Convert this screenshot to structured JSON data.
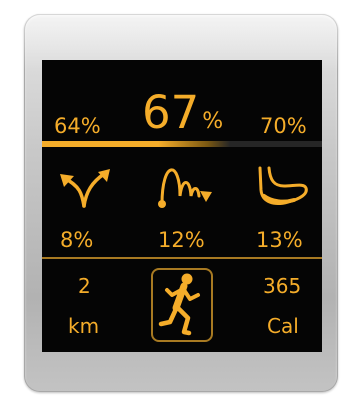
{
  "header": {
    "left_value": "64%",
    "main_value": "67",
    "main_unit": "%",
    "right_value": "70%",
    "progress_fraction": 0.67
  },
  "metrics": [
    {
      "icon": "direction-arrows-icon",
      "value": "8%"
    },
    {
      "icon": "bounce-wave-icon",
      "value": "12%"
    },
    {
      "icon": "foot-icon",
      "value": "13%"
    }
  ],
  "footer": {
    "distance_value": "2",
    "distance_unit": "km",
    "activity_icon": "runner-icon",
    "calories_value": "365",
    "calories_unit": "Cal"
  },
  "colors": {
    "accent": "#f5ad2a",
    "divider": "#a87a22",
    "screen_background": "#050505",
    "bezel": "#c4c4c4"
  }
}
